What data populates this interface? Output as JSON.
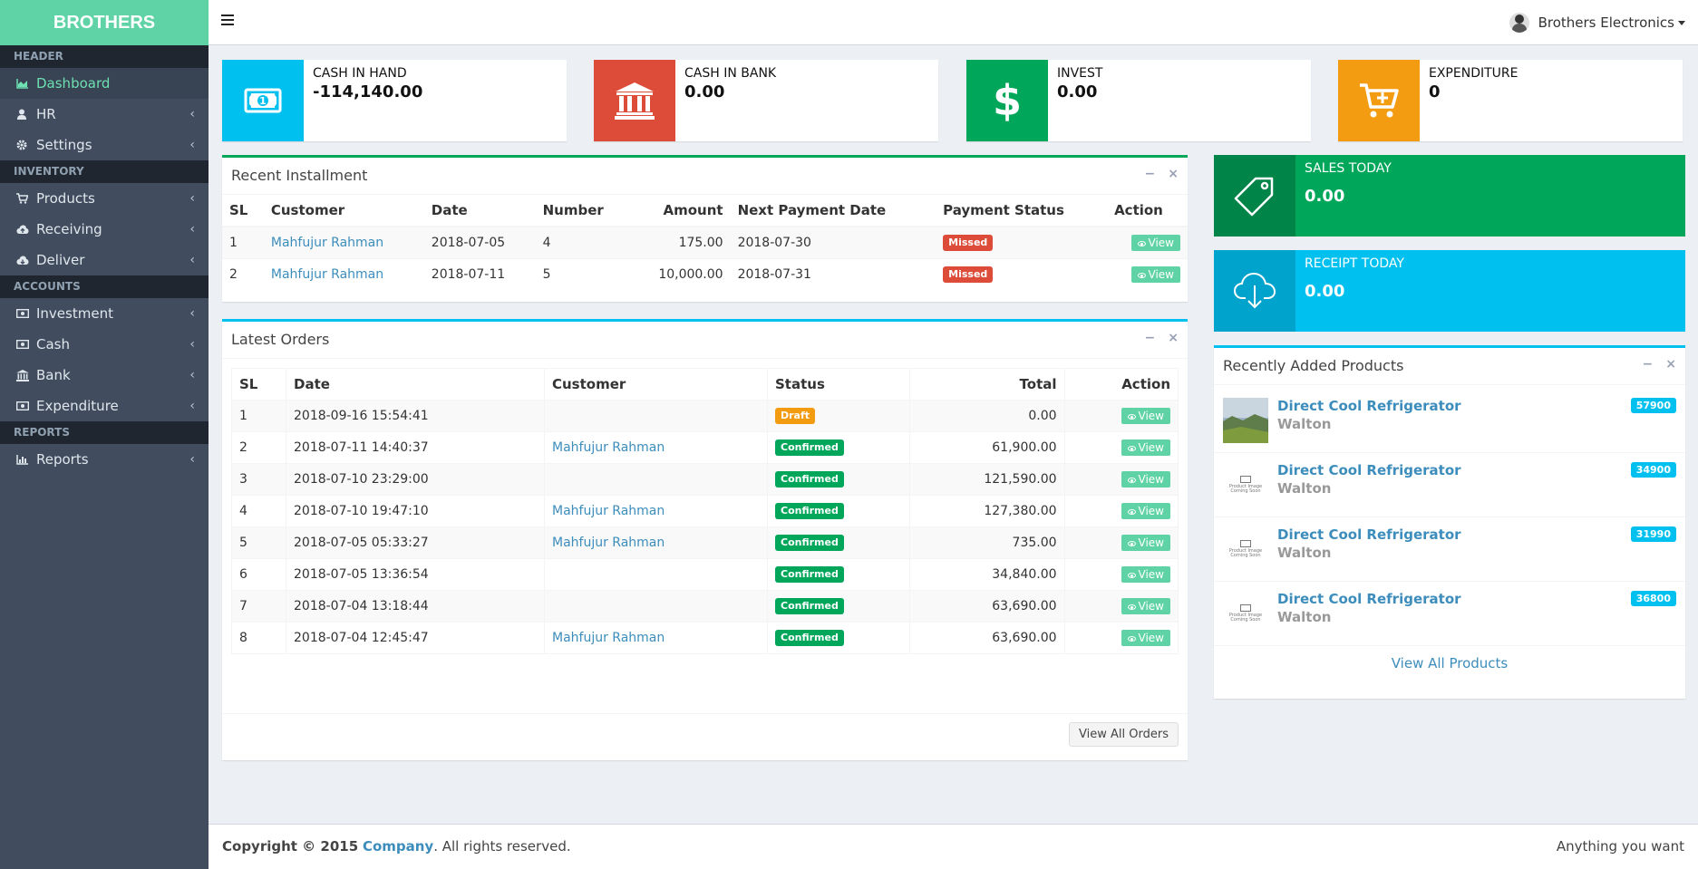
{
  "brand": "BROTHERS",
  "sidebar": {
    "sections": [
      {
        "header": "HEADER",
        "items": [
          {
            "label": "Dashboard",
            "icon": "area-chart-icon",
            "active": true
          },
          {
            "label": "HR",
            "icon": "user-icon"
          },
          {
            "label": "Settings",
            "icon": "gear-icon"
          }
        ]
      },
      {
        "header": "INVENTORY",
        "items": [
          {
            "label": "Products",
            "icon": "cart-icon"
          },
          {
            "label": "Receiving",
            "icon": "cloud-upload-icon"
          },
          {
            "label": "Deliver",
            "icon": "cloud-download-icon"
          }
        ]
      },
      {
        "header": "ACCOUNTS",
        "items": [
          {
            "label": "Investment",
            "icon": "money-icon"
          },
          {
            "label": "Cash",
            "icon": "money-icon"
          },
          {
            "label": "Bank",
            "icon": "bank-icon"
          },
          {
            "label": "Expenditure",
            "icon": "money-icon"
          }
        ]
      },
      {
        "header": "REPORTS",
        "items": [
          {
            "label": "Reports",
            "icon": "bar-chart-icon"
          }
        ]
      }
    ]
  },
  "topbar": {
    "user_name": "Brothers Electronics"
  },
  "infoboxes": [
    {
      "label": "CASH IN HAND",
      "value": "-114,140.00",
      "color": "#00c0ef",
      "icon": "money-icon"
    },
    {
      "label": "CASH IN BANK",
      "value": "0.00",
      "color": "#dd4b39",
      "icon": "bank-icon"
    },
    {
      "label": "INVEST",
      "value": "0.00",
      "color": "#00a65a",
      "icon": "dollar-icon"
    },
    {
      "label": "EXPENDITURE",
      "value": "0",
      "color": "#f39c12",
      "icon": "cart-plus-icon"
    }
  ],
  "installments": {
    "title": "Recent Installment",
    "columns": [
      "SL",
      "Customer",
      "Date",
      "Number",
      "Amount",
      "Next Payment Date",
      "Payment Status",
      "Action"
    ],
    "rows": [
      {
        "sl": "1",
        "customer": "Mahfujur Rahman",
        "date": "2018-07-05",
        "number": "4",
        "amount": "175.00",
        "next": "2018-07-30",
        "status": "Missed",
        "action": "View"
      },
      {
        "sl": "2",
        "customer": "Mahfujur Rahman",
        "date": "2018-07-11",
        "number": "5",
        "amount": "10,000.00",
        "next": "2018-07-31",
        "status": "Missed",
        "action": "View"
      }
    ]
  },
  "orders": {
    "title": "Latest Orders",
    "columns": [
      "SL",
      "Date",
      "Customer",
      "Status",
      "Total",
      "Action"
    ],
    "rows": [
      {
        "sl": "1",
        "date": "2018-09-16 15:54:41",
        "customer": "",
        "status": "Draft",
        "total": "0.00",
        "action": "View"
      },
      {
        "sl": "2",
        "date": "2018-07-11 14:40:37",
        "customer": "Mahfujur Rahman",
        "status": "Confirmed",
        "total": "61,900.00",
        "action": "View"
      },
      {
        "sl": "3",
        "date": "2018-07-10 23:29:00",
        "customer": "",
        "status": "Confirmed",
        "total": "121,590.00",
        "action": "View"
      },
      {
        "sl": "4",
        "date": "2018-07-10 19:47:10",
        "customer": "Mahfujur Rahman",
        "status": "Confirmed",
        "total": "127,380.00",
        "action": "View"
      },
      {
        "sl": "5",
        "date": "2018-07-05 05:33:27",
        "customer": "Mahfujur Rahman",
        "status": "Confirmed",
        "total": "735.00",
        "action": "View"
      },
      {
        "sl": "6",
        "date": "2018-07-05 13:36:54",
        "customer": "",
        "status": "Confirmed",
        "total": "34,840.00",
        "action": "View"
      },
      {
        "sl": "7",
        "date": "2018-07-04 13:18:44",
        "customer": "",
        "status": "Confirmed",
        "total": "63,690.00",
        "action": "View"
      },
      {
        "sl": "8",
        "date": "2018-07-04 12:45:47",
        "customer": "Mahfujur Rahman",
        "status": "Confirmed",
        "total": "63,690.00",
        "action": "View"
      }
    ],
    "view_all": "View All Orders"
  },
  "sales_today": {
    "label": "SALES TODAY",
    "value": "0.00",
    "color": "#00a65a",
    "icon": "tag-icon"
  },
  "receipt_today": {
    "label": "RECEIPT TODAY",
    "value": "0.00",
    "color": "#00c0ef",
    "icon": "cloud-download-icon"
  },
  "products": {
    "title": "Recently Added Products",
    "no_image_text": "Product Image Coming Soon",
    "items": [
      {
        "name": "Direct Cool Refrigerator",
        "brand": "Walton",
        "price": "57900",
        "image": "landscape"
      },
      {
        "name": "Direct Cool Refrigerator",
        "brand": "Walton",
        "price": "34900",
        "image": "placeholder"
      },
      {
        "name": "Direct Cool Refrigerator",
        "brand": "Walton",
        "price": "31990",
        "image": "placeholder"
      },
      {
        "name": "Direct Cool Refrigerator",
        "brand": "Walton",
        "price": "36800",
        "image": "placeholder"
      }
    ],
    "view_all": "View All Products"
  },
  "footer": {
    "copyright": "Copyright © 2015",
    "company": "Company",
    "rights": ". All rights reserved.",
    "right_text": "Anything you want"
  }
}
